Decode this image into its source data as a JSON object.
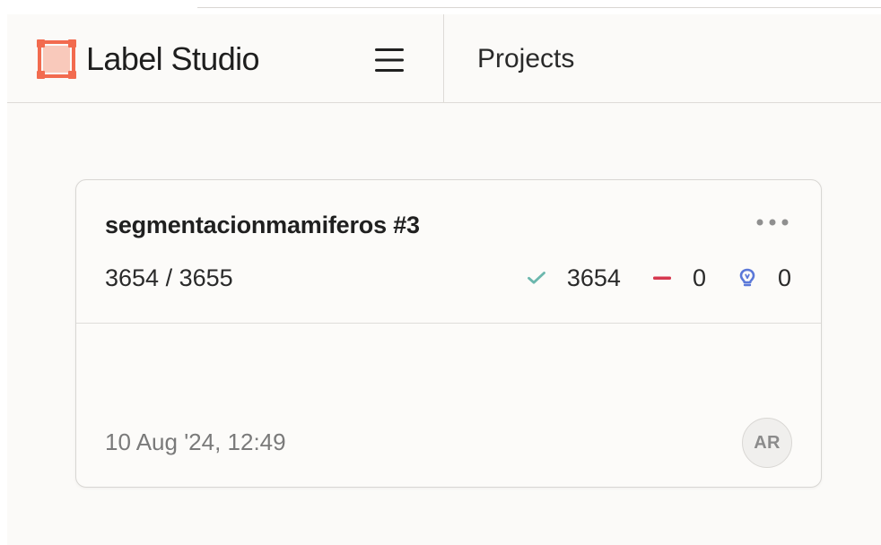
{
  "app": {
    "brand": "Label Studio",
    "brand_icon": "label-studio-logo-icon",
    "menu_icon": "hamburger-menu-icon",
    "nav_title": "Projects",
    "accent_color": "#f26b4f"
  },
  "project_card": {
    "title": "segmentacionmamiferos #3",
    "progress_text": "3654 / 3655",
    "stats": [
      {
        "name": "completed",
        "icon": "check-icon",
        "value": "3654",
        "color": "#6bb7ad"
      },
      {
        "name": "skipped",
        "icon": "minus-icon",
        "value": "0",
        "color": "#d6384f"
      },
      {
        "name": "predictions",
        "icon": "lightbulb-icon",
        "value": "0",
        "color": "#5b78d8"
      }
    ],
    "more_icon": "more-options-icon",
    "date_text": "10 Aug '24, 12:49",
    "avatar_initials": "AR"
  }
}
